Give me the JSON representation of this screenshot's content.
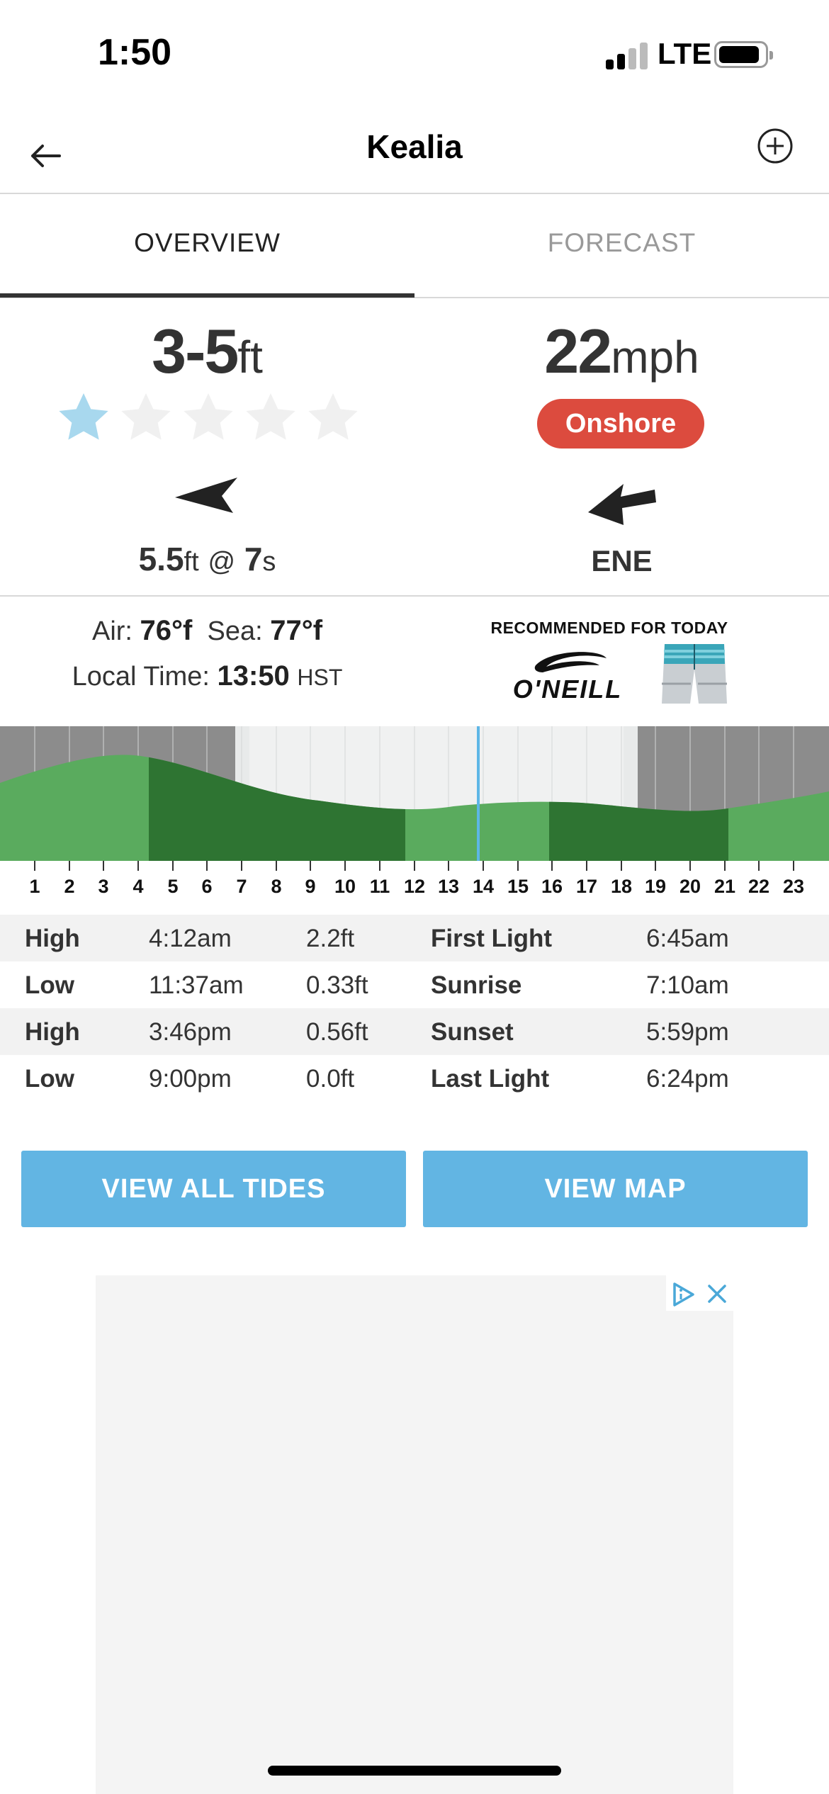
{
  "status_bar": {
    "time": "1:50",
    "network": "LTE"
  },
  "nav": {
    "title": "Kealia",
    "back_icon": "arrow-left-icon",
    "add_icon": "plus-circle-icon"
  },
  "tabs": [
    {
      "label": "OVERVIEW",
      "active": true
    },
    {
      "label": "FORECAST",
      "active": false
    }
  ],
  "surf": {
    "height": "3-5",
    "height_unit": "ft",
    "rating": 1,
    "rating_max": 5,
    "swell_height": "5.5",
    "swell_unit": "ft",
    "swell_at": "@",
    "swell_period": "7",
    "swell_period_unit": "s"
  },
  "wind": {
    "speed": "22",
    "unit": "mph",
    "condition": "Onshore",
    "direction": "ENE",
    "condition_color": "#dc4b3e"
  },
  "conditions": {
    "air_label": "Air:",
    "air_temp": "76°f",
    "sea_label": "Sea:",
    "sea_temp": "77°f",
    "local_time_label": "Local Time:",
    "local_time": "13:50",
    "timezone": "HST"
  },
  "recommendation": {
    "label": "RECOMMENDED FOR TODAY",
    "brand": "O'NEILL"
  },
  "tide_chart": {
    "hours": [
      "1",
      "2",
      "3",
      "4",
      "5",
      "6",
      "7",
      "8",
      "9",
      "10",
      "11",
      "12",
      "13",
      "14",
      "15",
      "16",
      "17",
      "18",
      "19",
      "20",
      "21",
      "22",
      "23"
    ],
    "current_hour": 13.83
  },
  "tides": [
    {
      "type": "High",
      "time": "4:12am",
      "height": "2.2ft",
      "sun_label": "First Light",
      "sun_time": "6:45am"
    },
    {
      "type": "Low",
      "time": "11:37am",
      "height": "0.33ft",
      "sun_label": "Sunrise",
      "sun_time": "7:10am"
    },
    {
      "type": "High",
      "time": "3:46pm",
      "height": "0.56ft",
      "sun_label": "Sunset",
      "sun_time": "5:59pm"
    },
    {
      "type": "Low",
      "time": "9:00pm",
      "height": "0.0ft",
      "sun_label": "Last Light",
      "sun_time": "6:24pm"
    }
  ],
  "buttons": {
    "tides": "VIEW ALL TIDES",
    "map": "VIEW MAP"
  },
  "colors": {
    "accent": "#62b5e3",
    "tide_light": "#5aab5e",
    "tide_dark": "#2e7432",
    "star": "#a8d8ee",
    "star_empty": "#f0f0f0"
  }
}
